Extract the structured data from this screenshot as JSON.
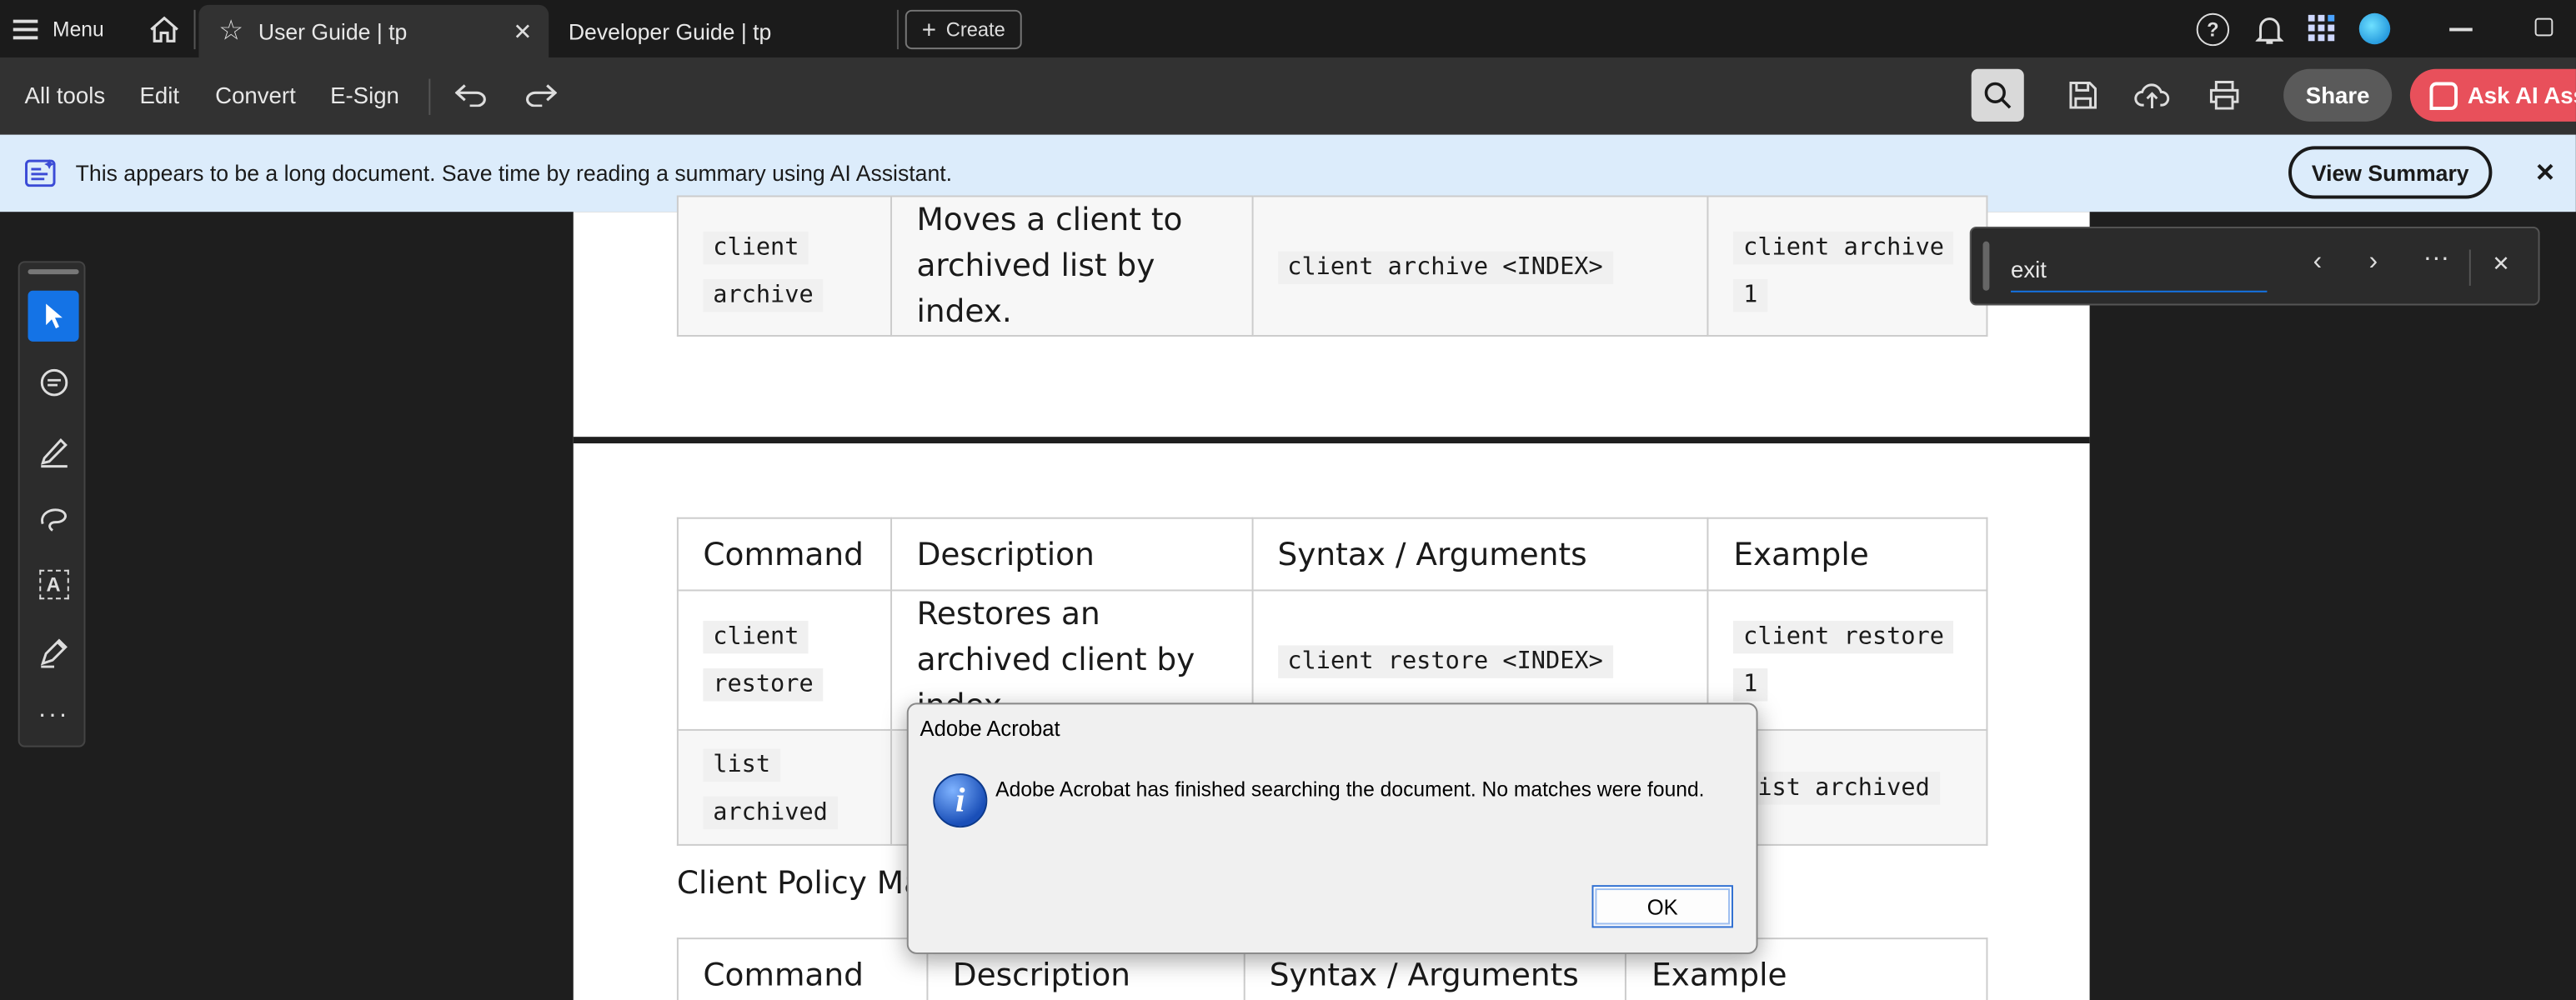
{
  "tabbar": {
    "menu_label": "Menu",
    "tabs": [
      {
        "label": "User Guide | tp",
        "active": true
      },
      {
        "label": "Developer Guide | tp",
        "active": false
      }
    ],
    "create_label": "Create"
  },
  "toolbar": {
    "items": [
      "All tools",
      "Edit",
      "Convert",
      "E-Sign"
    ],
    "share_label": "Share",
    "ask_ai_label": "Ask AI Assi"
  },
  "banner": {
    "message": "This appears to be a long document. Save time by reading a summary using AI Assistant.",
    "button_label": "View Summary"
  },
  "find": {
    "value": "exit"
  },
  "document": {
    "table_top": {
      "row": {
        "command_a": "client",
        "command_b": "archive",
        "description": "Moves a client to archived list by index.",
        "syntax": "client archive <INDEX>",
        "example_a": "client archive",
        "example_b": "1"
      }
    },
    "table_main": {
      "headers": [
        "Command",
        "Description",
        "Syntax / Arguments",
        "Example"
      ],
      "rows": [
        {
          "command_a": "client",
          "command_b": "restore",
          "description": "Restores an archived client by index.",
          "syntax": "client restore <INDEX>",
          "example_a": "client restore",
          "example_b": "1"
        },
        {
          "command_a": "list",
          "command_b": "archived",
          "description": "",
          "syntax": "",
          "example_a": "list archived",
          "example_b": ""
        }
      ]
    },
    "section_heading": "Client Policy Mar",
    "table_bottom": {
      "headers": [
        "Command",
        "Description",
        "Syntax / Arguments",
        "Example"
      ]
    }
  },
  "dialog": {
    "title": "Adobe Acrobat",
    "message": "Adobe Acrobat has finished searching the document. No matches were found.",
    "ok_label": "OK"
  },
  "colors": {
    "accent_blue": "#1473e6",
    "banner_bg": "#dcecfb",
    "ask_ai_bg": "#e8505b"
  }
}
